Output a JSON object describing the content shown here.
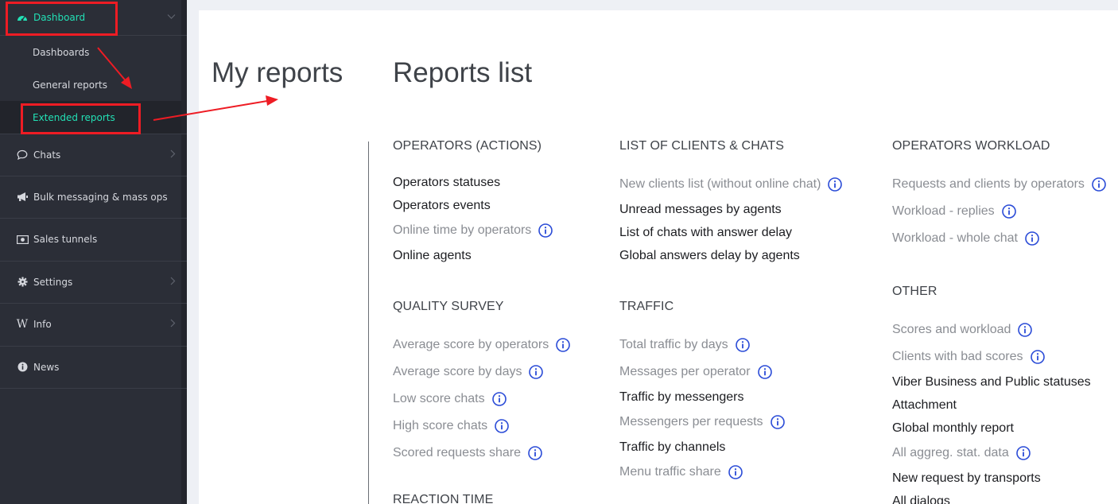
{
  "sidebar": {
    "dashboard": {
      "label": "Dashboard"
    },
    "sub_items": [
      {
        "label": "Dashboards",
        "active": false
      },
      {
        "label": "General reports",
        "active": false
      },
      {
        "label": "Extended reports",
        "active": true
      }
    ],
    "items": [
      {
        "label": "Chats",
        "icon": "speech-bubble-icon",
        "chevron": true
      },
      {
        "label": "Bulk messaging & mass ops",
        "icon": "megaphone-icon",
        "chevron": false
      },
      {
        "label": "Sales tunnels",
        "icon": "money-icon",
        "chevron": false
      },
      {
        "label": "Settings",
        "icon": "gear-icon",
        "chevron": true
      },
      {
        "label": "Info",
        "icon": "wikipedia-icon",
        "chevron": true
      },
      {
        "label": "News",
        "icon": "info-circle-icon",
        "chevron": false
      }
    ]
  },
  "main": {
    "my_reports_title": "My reports",
    "reports_list_title": "Reports list",
    "sections": [
      {
        "title": "OPERATORS (ACTIONS)",
        "items": [
          {
            "label": "Operators statuses",
            "style": "dark",
            "info": false
          },
          {
            "label": "Operators events",
            "style": "dark",
            "info": false
          },
          {
            "label": "Online time by operators",
            "style": "grey",
            "info": true
          },
          {
            "label": "Online agents",
            "style": "dark",
            "info": false
          }
        ]
      },
      {
        "title": "LIST OF CLIENTS & CHATS",
        "items": [
          {
            "label": "New clients list (without online chat)",
            "style": "grey",
            "info": true
          },
          {
            "label": "Unread messages by agents",
            "style": "dark",
            "info": false
          },
          {
            "label": "List of chats with answer delay",
            "style": "dark",
            "info": false
          },
          {
            "label": "Global answers delay by agents",
            "style": "dark",
            "info": false
          }
        ]
      },
      {
        "title": "OPERATORS WORKLOAD",
        "items": [
          {
            "label": "Requests and clients by operators",
            "style": "grey",
            "info": true
          },
          {
            "label": "Workload - replies",
            "style": "grey",
            "info": true
          },
          {
            "label": "Workload - whole chat",
            "style": "grey",
            "info": true
          }
        ]
      },
      {
        "title": "QUALITY SURVEY",
        "items": [
          {
            "label": "Average score by operators",
            "style": "grey",
            "info": true
          },
          {
            "label": "Average score by days",
            "style": "grey",
            "info": true
          },
          {
            "label": "Low score chats",
            "style": "grey",
            "info": true
          },
          {
            "label": "High score chats",
            "style": "grey",
            "info": true
          },
          {
            "label": "Scored requests share",
            "style": "grey",
            "info": true
          }
        ]
      },
      {
        "title": "TRAFFIC",
        "items": [
          {
            "label": "Total traffic by days",
            "style": "grey",
            "info": true
          },
          {
            "label": "Messages per operator",
            "style": "grey",
            "info": true
          },
          {
            "label": "Traffic by messengers",
            "style": "dark",
            "info": false
          },
          {
            "label": "Messengers per requests",
            "style": "grey",
            "info": true
          },
          {
            "label": "Traffic by channels",
            "style": "dark",
            "info": false
          },
          {
            "label": "Menu traffic share",
            "style": "grey",
            "info": true
          }
        ]
      },
      {
        "title": "OTHER",
        "items": [
          {
            "label": "Scores and workload",
            "style": "grey",
            "info": true
          },
          {
            "label": "Clients with bad scores",
            "style": "grey",
            "info": true
          },
          {
            "label": "Viber Business and Public statuses",
            "style": "dark",
            "info": false
          },
          {
            "label": "Attachment",
            "style": "dark",
            "info": false
          },
          {
            "label": "Global monthly report",
            "style": "dark",
            "info": false
          },
          {
            "label": "All aggreg. stat. data",
            "style": "grey",
            "info": true
          },
          {
            "label": "New request by transports",
            "style": "dark",
            "info": false
          },
          {
            "label": "All dialogs",
            "style": "dark",
            "info": false
          }
        ]
      },
      {
        "title": "REACTION TIME",
        "items": []
      }
    ]
  },
  "colors": {
    "accent": "#22e0b5",
    "sidebar_bg": "#2b2e37",
    "annotation_red": "#ee1c24",
    "info_blue": "#2a4bd7"
  }
}
